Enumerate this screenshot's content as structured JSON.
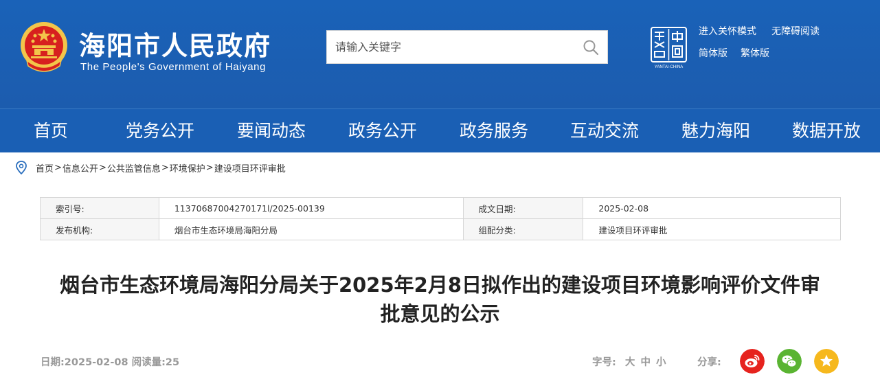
{
  "header": {
    "site_title": "海阳市人民政府",
    "site_subtitle": "The People's Government of Haiyang",
    "search_placeholder": "请输入关键字",
    "top_links": [
      "进入关怀模式",
      "无障碍阅读",
      "简体版",
      "繁体版"
    ],
    "yantai_logo_text": "YANTAI·CHINA",
    "colors": {
      "header_bg": "#1a5fb4",
      "emblem_red": "#d7201f",
      "emblem_gold": "#f3c54a"
    }
  },
  "nav": {
    "items": [
      "首页",
      "党务公开",
      "要闻动态",
      "政务公开",
      "政务服务",
      "互动交流",
      "魅力海阳",
      "数据开放"
    ]
  },
  "breadcrumb": {
    "items": [
      "首页",
      "信息公开",
      "公共监管信息",
      "环境保护",
      "建设项目环评审批"
    ],
    "separator": ">"
  },
  "meta": {
    "rows": [
      [
        {
          "label": "索引号:",
          "value": "11370687004270171l/2025-00139"
        },
        {
          "label": "成文日期:",
          "value": "2025-02-08"
        }
      ],
      [
        {
          "label": "发布机构:",
          "value": "烟台市生态环境局海阳分局"
        },
        {
          "label": "组配分类:",
          "value": "建设项目环评审批"
        }
      ]
    ]
  },
  "article": {
    "title_line1": "烟台市生态环境局海阳分局关于2025年2月8日拟作出的建设项目环境影响评价文件审",
    "title_line2": "批意见的公示",
    "info": "日期:2025-02-08 阅读量:25",
    "font_size_label": "字号:",
    "font_sizes": [
      "大",
      "中",
      "小"
    ],
    "share_label": "分享:",
    "share_colors": {
      "weibo": "#e6231e",
      "wechat": "#5ab432",
      "favorite": "#f6b81d"
    }
  }
}
